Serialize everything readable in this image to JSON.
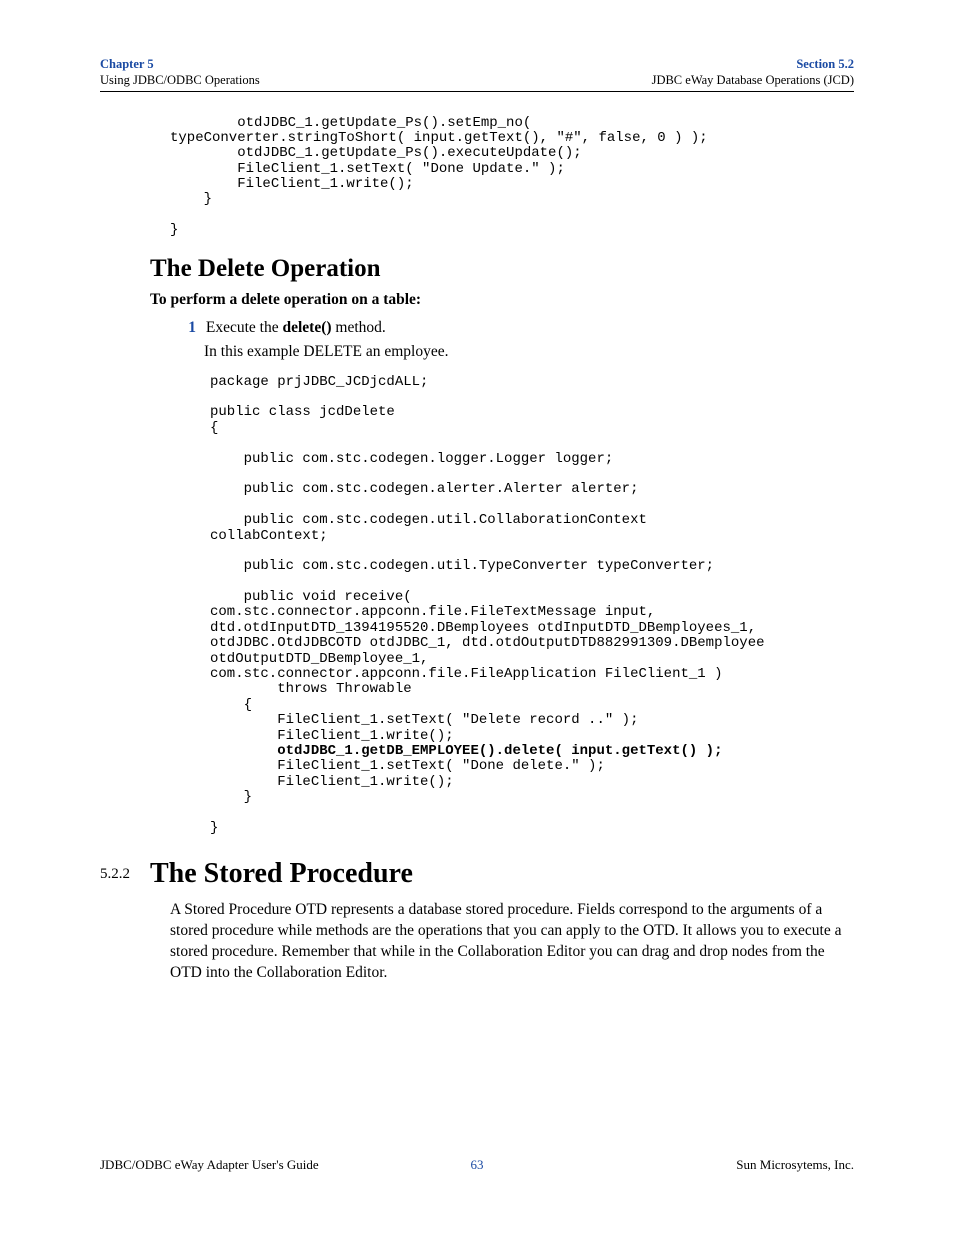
{
  "header": {
    "chapter": "Chapter 5",
    "chapter_sub": "Using JDBC/ODBC Operations",
    "section": "Section 5.2",
    "section_sub": "JDBC eWay Database Operations (JCD)"
  },
  "code_top": "        otdJDBC_1.getUpdate_Ps().setEmp_no( \ntypeConverter.stringToShort( input.getText(), \"#\", false, 0 ) );\n        otdJDBC_1.getUpdate_Ps().executeUpdate();\n        FileClient_1.setText( \"Done Update.\" );\n        FileClient_1.write();\n    }\n\n}",
  "delete": {
    "heading": "The Delete Operation",
    "subtitle": "To perform a delete operation on a table:",
    "step_num": "1",
    "step_text_pre": "Execute the ",
    "step_text_bold": "delete()",
    "step_text_post": " method.",
    "step_sub": "In this example DELETE an employee.",
    "code_pre": "package prjJDBC_JCDjcdALL;\n\npublic class jcdDelete\n{\n\n    public com.stc.codegen.logger.Logger logger;\n\n    public com.stc.codegen.alerter.Alerter alerter;\n\n    public com.stc.codegen.util.CollaborationContext \ncollabContext;\n\n    public com.stc.codegen.util.TypeConverter typeConverter;\n\n    public void receive( \ncom.stc.connector.appconn.file.FileTextMessage input, \ndtd.otdInputDTD_1394195520.DBemployees otdInputDTD_DBemployees_1, \notdJDBC.OtdJDBCOTD otdJDBC_1, dtd.otdOutputDTD882991309.DBemployee \notdOutputDTD_DBemployee_1, \ncom.stc.connector.appconn.file.FileApplication FileClient_1 )\n        throws Throwable\n    {\n        FileClient_1.setText( \"Delete record ..\" );\n        FileClient_1.write();\n",
    "code_bold": "        otdJDBC_1.getDB_EMPLOYEE().delete( input.getText() );\n",
    "code_post": "        FileClient_1.setText( \"Done delete.\" );\n        FileClient_1.write();\n    }\n\n}"
  },
  "stored": {
    "sec_num": "5.2.2",
    "heading": "The Stored Procedure",
    "para": "A Stored Procedure OTD represents a database stored procedure. Fields correspond to the arguments of a stored procedure while methods are the operations that you can apply to the OTD. It allows you to execute a stored procedure. Remember that while in the Collaboration Editor you can drag and drop nodes from the OTD into the Collaboration Editor."
  },
  "footer": {
    "left": "JDBC/ODBC eWay Adapter User's Guide",
    "center": "63",
    "right": "Sun Microsytems, Inc."
  }
}
